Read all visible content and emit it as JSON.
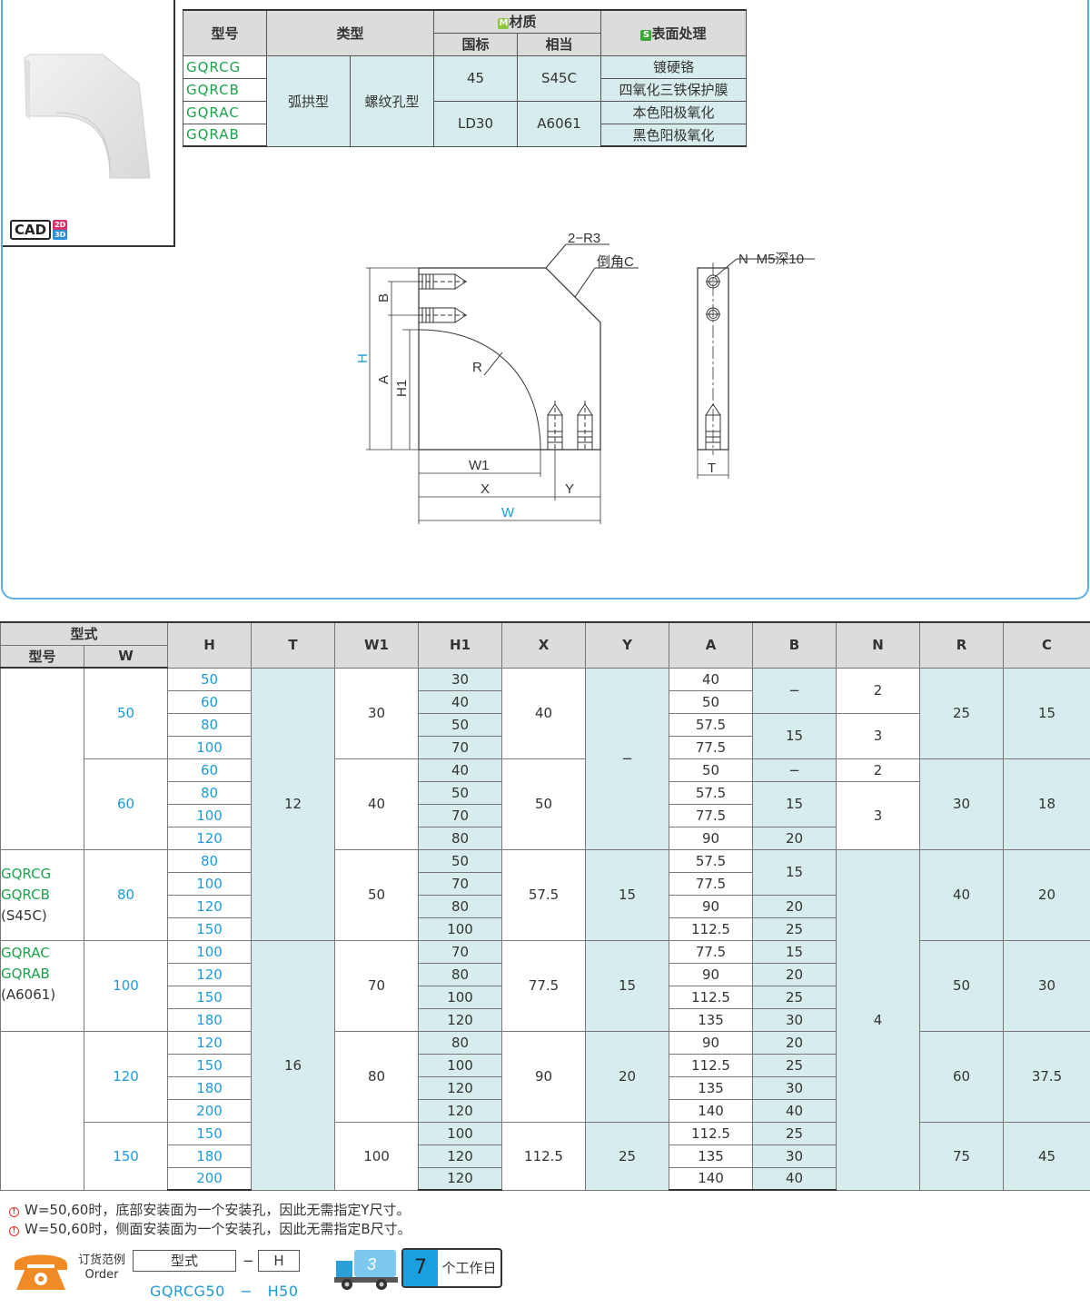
{
  "cad": {
    "label": "CAD",
    "b2d": "2D",
    "b3d": "3D"
  },
  "type_table": {
    "h_model": "型号",
    "h_type": "类型",
    "h_material": "材质",
    "h_material_badge": "M",
    "h_gb": "国标",
    "h_equiv": "相当",
    "h_surface": "表面处理",
    "h_surface_badge": "S",
    "codes": [
      "GQRCG",
      "GQRCB",
      "GQRAC",
      "GQRAB"
    ],
    "type1": "弧拱型",
    "type2": "螺纹孔型",
    "gb_1": "45",
    "eq_1": "S45C",
    "gb_2": "LD30",
    "eq_2": "A6061",
    "surfaces": [
      "镀硬铬",
      "四氧化三铁保护膜",
      "本色阳极氧化",
      "黑色阳极氧化"
    ]
  },
  "drawing": {
    "r3": "2−R3",
    "chamfer": "倒角C",
    "tap": "N−M5深10",
    "B": "B",
    "H": "H",
    "A": "A",
    "H1": "H1",
    "R": "R",
    "W1": "W1",
    "X": "X",
    "Y": "Y",
    "W": "W",
    "T": "T"
  },
  "data_table": {
    "h_form": "型式",
    "h_model": "型号",
    "h_W": "W",
    "cols": [
      "H",
      "T",
      "W1",
      "H1",
      "X",
      "Y",
      "A",
      "B",
      "N",
      "R",
      "C"
    ],
    "model_group1": [
      "GQRCG",
      "GQRCB",
      "(S45C)"
    ],
    "model_group2": [
      "GQRAC",
      "GQRAB",
      "(A6061)"
    ],
    "W": [
      "50",
      "60",
      "80",
      "100",
      "120",
      "150"
    ],
    "H": [
      "50",
      "60",
      "80",
      "100",
      "60",
      "80",
      "100",
      "120",
      "80",
      "100",
      "120",
      "150",
      "100",
      "120",
      "150",
      "180",
      "120",
      "150",
      "180",
      "200",
      "150",
      "180",
      "200"
    ],
    "T": [
      "12",
      "16"
    ],
    "W1": [
      "30",
      "40",
      "50",
      "70",
      "80",
      "100"
    ],
    "H1": [
      "30",
      "40",
      "50",
      "70",
      "40",
      "50",
      "70",
      "80",
      "50",
      "70",
      "80",
      "100",
      "70",
      "80",
      "100",
      "120",
      "80",
      "100",
      "120",
      "120",
      "100",
      "120",
      "120"
    ],
    "X": [
      "40",
      "50",
      "57.5",
      "77.5",
      "90",
      "112.5"
    ],
    "Y": [
      "−",
      "15",
      "15",
      "20",
      "25"
    ],
    "A": [
      "40",
      "50",
      "57.5",
      "77.5",
      "50",
      "57.5",
      "77.5",
      "90",
      "57.5",
      "77.5",
      "90",
      "112.5",
      "77.5",
      "90",
      "112.5",
      "135",
      "90",
      "112.5",
      "135",
      "140",
      "112.5",
      "135",
      "140"
    ],
    "B": [
      "−",
      "15",
      "−",
      "15",
      "20",
      "15",
      "20",
      "25",
      "15",
      "20",
      "25",
      "30",
      "20",
      "25",
      "30",
      "40",
      "25",
      "30",
      "40"
    ],
    "N": [
      "2",
      "3",
      "2",
      "3",
      "4"
    ],
    "R": [
      "25",
      "30",
      "40",
      "50",
      "60",
      "75"
    ],
    "C": [
      "15",
      "18",
      "20",
      "30",
      "37.5",
      "45"
    ]
  },
  "notes": [
    "W=50,60时，底部安装面为一个安装孔，因此无需指定Y尺寸。",
    "W=50,60时，侧面安装面为一个安装孔，因此无需指定B尺寸。"
  ],
  "order": {
    "label_cn": "订货范例",
    "label_en": "Order",
    "box_model": "型式",
    "dash": "−",
    "box_h": "H",
    "example": "GQRCG50　−　H50",
    "truck_days": "3",
    "days": "7",
    "days_unit": "个工作日"
  },
  "colors": {
    "accent_blue": "#1e9ad6",
    "code_green": "#1aa34a",
    "teal_bg": "#d7ecec",
    "panel_border": "#5fb0e0"
  }
}
